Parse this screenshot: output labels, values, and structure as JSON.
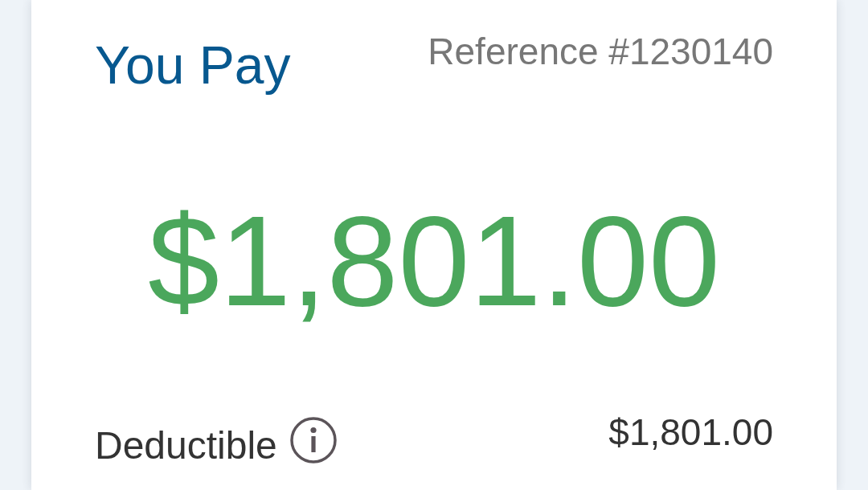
{
  "card": {
    "title": "You Pay",
    "reference": "Reference #1230140",
    "amount": "$1,801.00",
    "breakdown": [
      {
        "label": "Deductible",
        "amount": "$1,801.00"
      }
    ]
  }
}
